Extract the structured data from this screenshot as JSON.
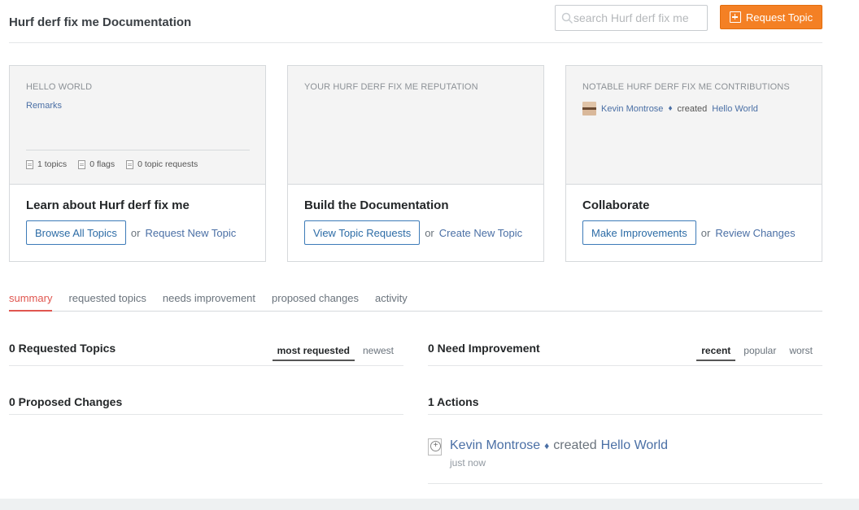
{
  "header": {
    "title": "Hurf derf fix me Documentation",
    "search_placeholder": "search Hurf derf fix me",
    "request_button": "Request Topic",
    "request_icon": "plus-square-icon",
    "accent_color": "#f48024"
  },
  "cards": [
    {
      "label": "HELLO WORLD",
      "link": "Remarks",
      "stats": [
        {
          "icon": "document-icon",
          "text": "1 topics"
        },
        {
          "icon": "flag-document-icon",
          "text": "0 flags"
        },
        {
          "icon": "request-document-icon",
          "text": "0 topic requests"
        }
      ],
      "heading": "Learn about Hurf derf fix me",
      "button": "Browse All Topics",
      "or": "or",
      "alt_link": "Request New Topic"
    },
    {
      "label": "YOUR HURF DERF FIX ME REPUTATION",
      "heading": "Build the Documentation",
      "button": "View Topic Requests",
      "or": "or",
      "alt_link": "Create New Topic"
    },
    {
      "label": "NOTABLE HURF DERF FIX ME CONTRIBUTIONS",
      "contribution": {
        "user": "Kevin Montrose",
        "badge": "♦",
        "verb": "created",
        "target": "Hello World"
      },
      "heading": "Collaborate",
      "button": "Make Improvements",
      "or": "or",
      "alt_link": "Review Changes"
    }
  ],
  "tabs": [
    {
      "label": "summary",
      "active": true
    },
    {
      "label": "requested topics"
    },
    {
      "label": "needs improvement"
    },
    {
      "label": "proposed changes"
    },
    {
      "label": "activity"
    }
  ],
  "sections": {
    "requested": {
      "title": "0 Requested Topics",
      "sorts": [
        "most requested",
        "newest"
      ],
      "active": "most requested"
    },
    "improvement": {
      "title": "0 Need Improvement",
      "sorts": [
        "recent",
        "popular",
        "worst"
      ],
      "active": "recent"
    },
    "proposed": {
      "title": "0 Proposed Changes"
    },
    "actions": {
      "title": "1 Actions"
    }
  },
  "activity": {
    "user": "Kevin Montrose",
    "badge": "♦",
    "verb": "created",
    "target": "Hello World",
    "time": "just now"
  }
}
